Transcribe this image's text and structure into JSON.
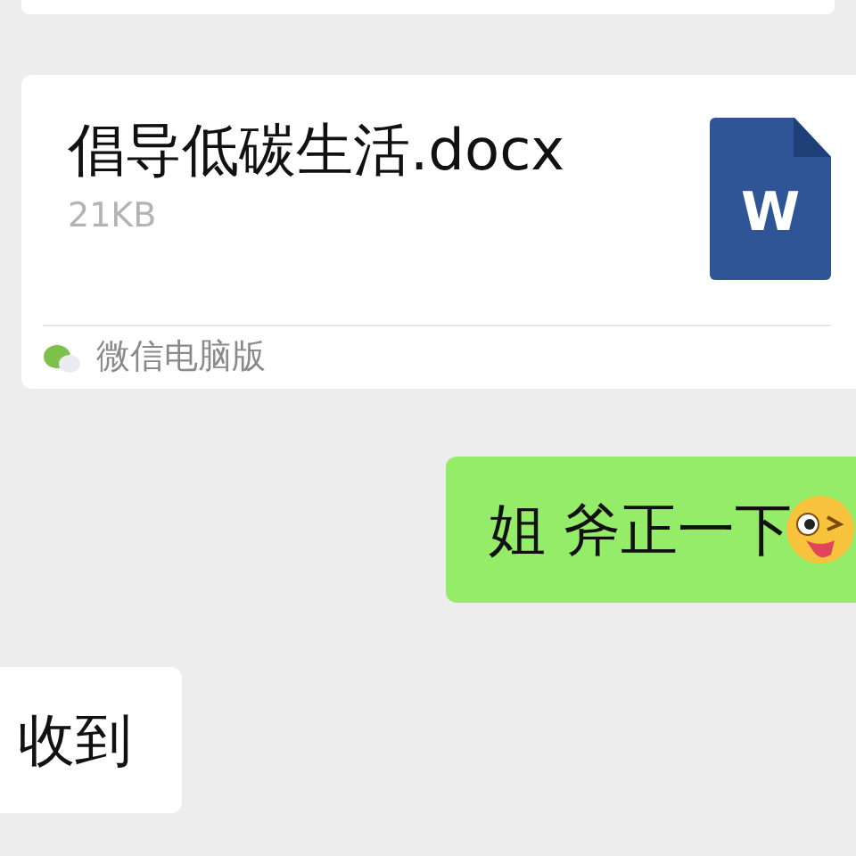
{
  "messages": [
    {
      "kind": "file",
      "outgoing": false,
      "file_name": "倡导低碳生活.docx",
      "file_size": "21KB",
      "file_icon_letter": "W",
      "source": "微信电脑版"
    },
    {
      "kind": "text",
      "outgoing": true,
      "text": "姐 斧正一下",
      "emoji": true
    },
    {
      "kind": "text",
      "outgoing": false,
      "text": "收到",
      "emoji": false
    }
  ]
}
